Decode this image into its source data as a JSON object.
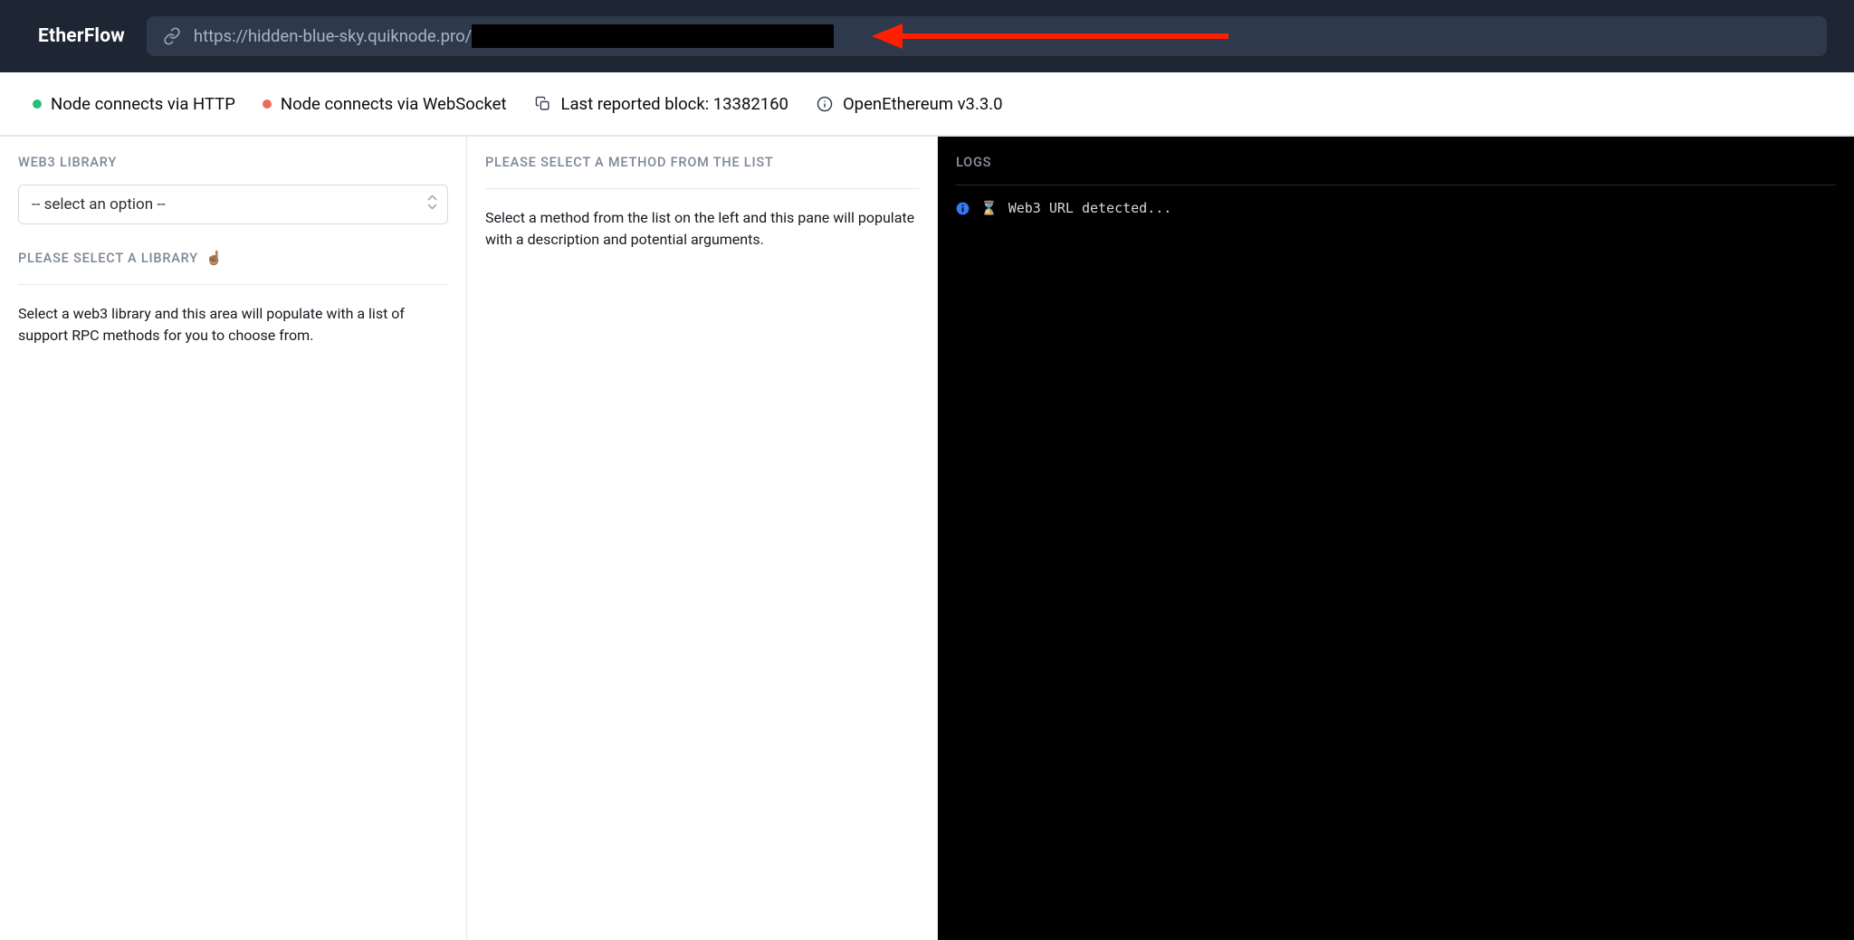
{
  "header": {
    "logo": "EtherFlow",
    "url_visible": "https://hidden-blue-sky.quiknode.pro/"
  },
  "status_bar": {
    "http_label": "Node connects via HTTP",
    "ws_label": "Node connects via WebSocket",
    "block_label": "Last reported block: 13382160",
    "client_label": "OpenEthereum v3.3.0"
  },
  "left_panel": {
    "heading": "WEB3 LIBRARY",
    "select_placeholder": "-- select an option --",
    "sub_heading": "PLEASE SELECT A LIBRARY",
    "emoji": "☝🏽",
    "description": "Select a web3 library and this area will populate with a list of support RPC methods for you to choose from."
  },
  "center_panel": {
    "heading": "PLEASE SELECT A METHOD FROM THE LIST",
    "description": "Select a method from the list on the left and this pane will populate with a description and potential arguments."
  },
  "right_panel": {
    "heading": "LOGS",
    "logs": [
      {
        "icon": "ℹ",
        "emoji": "⌛",
        "text": "Web3 URL detected..."
      }
    ]
  }
}
